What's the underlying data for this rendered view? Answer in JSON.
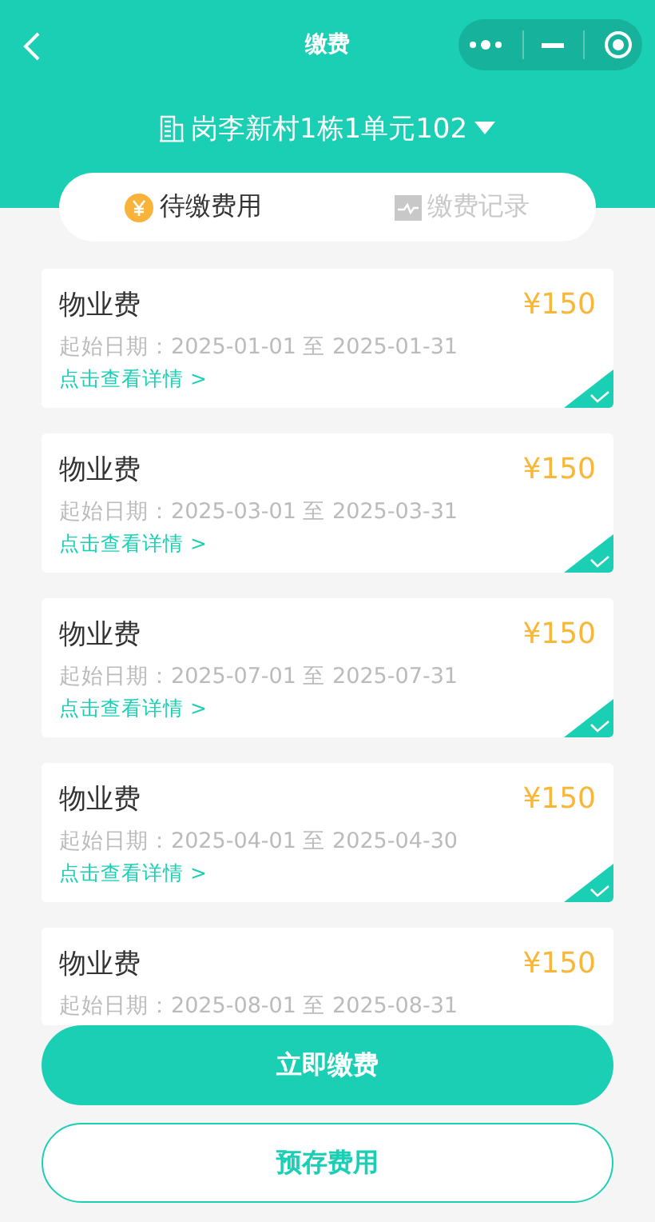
{
  "title": "缴费",
  "address": "岗李新村1栋1单元102",
  "tabs": [
    {
      "label": "待缴费用",
      "selected": true,
      "kind": "pending"
    },
    {
      "label": "缴费记录",
      "selected": false,
      "kind": "history"
    }
  ],
  "bills": [
    {
      "name": "物业费",
      "amount": "¥150",
      "period": "起始日期：2025-01-01 至 2025-01-31",
      "link": "点击查看详情 >",
      "selected": true
    },
    {
      "name": "物业费",
      "amount": "¥150",
      "period": "起始日期：2025-03-01 至 2025-03-31",
      "link": "点击查看详情 >",
      "selected": true
    },
    {
      "name": "物业费",
      "amount": "¥150",
      "period": "起始日期：2025-07-01 至 2025-07-31",
      "link": "点击查看详情 >",
      "selected": true
    },
    {
      "name": "物业费",
      "amount": "¥150",
      "period": "起始日期：2025-04-01 至 2025-04-30",
      "link": "点击查看详情 >",
      "selected": true
    },
    {
      "name": "物业费",
      "amount": "¥150",
      "period": "起始日期：2025-08-01 至 2025-08-31"
    }
  ],
  "buttons": [
    {
      "label": "立即缴费",
      "kind": "primary"
    },
    {
      "label": "预存费用",
      "kind": "outline"
    }
  ]
}
